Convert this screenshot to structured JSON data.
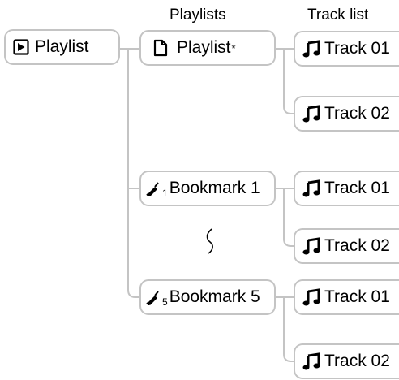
{
  "headers": {
    "playlists": "Playlists",
    "track_list": "Track list"
  },
  "root": {
    "label": "Playlist",
    "icon": "playlist-play-icon"
  },
  "playlists": [
    {
      "label": "Playlist",
      "suffix": "*",
      "icon": "document-icon"
    },
    {
      "label": "Bookmark 1",
      "icon": "bookmark-icon",
      "subscript": "1"
    },
    {
      "label": "Bookmark 5",
      "icon": "bookmark-icon",
      "subscript": "5"
    }
  ],
  "tracks": [
    {
      "label": "Track 01",
      "icon": "music-note-icon"
    },
    {
      "label": "Track 02",
      "icon": "music-note-icon"
    },
    {
      "label": "Track 01",
      "icon": "music-note-icon"
    },
    {
      "label": "Track 02",
      "icon": "music-note-icon"
    },
    {
      "label": "Track 01",
      "icon": "music-note-icon"
    },
    {
      "label": "Track 02",
      "icon": "music-note-icon"
    }
  ],
  "ellipsis_icon": "wavy-continuation-icon",
  "colors": {
    "border": "#c4c4c4",
    "text": "#000000"
  }
}
